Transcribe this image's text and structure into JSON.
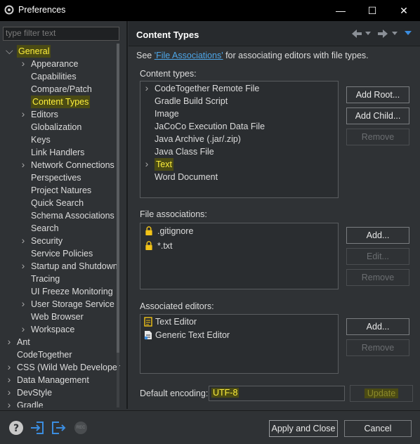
{
  "window": {
    "title": "Preferences",
    "controls": {
      "minimize": "—",
      "maximize": "☐",
      "close": "✕"
    }
  },
  "left": {
    "filter_placeholder": "type filter text",
    "tree": [
      {
        "label": "General",
        "level": 0,
        "expander": "open",
        "highlight": true
      },
      {
        "label": "Appearance",
        "level": 1,
        "expander": "closed"
      },
      {
        "label": "Capabilities",
        "level": 1,
        "expander": "none"
      },
      {
        "label": "Compare/Patch",
        "level": 1,
        "expander": "none"
      },
      {
        "label": "Content Types",
        "level": 1,
        "expander": "none",
        "highlight": true,
        "selected": true
      },
      {
        "label": "Editors",
        "level": 1,
        "expander": "closed"
      },
      {
        "label": "Globalization",
        "level": 1,
        "expander": "none"
      },
      {
        "label": "Keys",
        "level": 1,
        "expander": "none"
      },
      {
        "label": "Link Handlers",
        "level": 1,
        "expander": "none"
      },
      {
        "label": "Network Connections",
        "level": 1,
        "expander": "closed"
      },
      {
        "label": "Perspectives",
        "level": 1,
        "expander": "none"
      },
      {
        "label": "Project Natures",
        "level": 1,
        "expander": "none"
      },
      {
        "label": "Quick Search",
        "level": 1,
        "expander": "none"
      },
      {
        "label": "Schema Associations",
        "level": 1,
        "expander": "none"
      },
      {
        "label": "Search",
        "level": 1,
        "expander": "none"
      },
      {
        "label": "Security",
        "level": 1,
        "expander": "closed"
      },
      {
        "label": "Service Policies",
        "level": 1,
        "expander": "none"
      },
      {
        "label": "Startup and Shutdown",
        "level": 1,
        "expander": "closed"
      },
      {
        "label": "Tracing",
        "level": 1,
        "expander": "none"
      },
      {
        "label": "UI Freeze Monitoring",
        "level": 1,
        "expander": "none"
      },
      {
        "label": "User Storage Service",
        "level": 1,
        "expander": "closed"
      },
      {
        "label": "Web Browser",
        "level": 1,
        "expander": "none"
      },
      {
        "label": "Workspace",
        "level": 1,
        "expander": "closed"
      },
      {
        "label": "Ant",
        "level": 0,
        "expander": "closed"
      },
      {
        "label": "CodeTogether",
        "level": 0,
        "expander": "none"
      },
      {
        "label": "CSS (Wild Web Developer",
        "level": 0,
        "expander": "closed"
      },
      {
        "label": "Data Management",
        "level": 0,
        "expander": "closed"
      },
      {
        "label": "DevStyle",
        "level": 0,
        "expander": "closed"
      },
      {
        "label": "Gradle",
        "level": 0,
        "expander": "closed"
      }
    ]
  },
  "page": {
    "title": "Content Types",
    "see_prefix": "See ",
    "see_link": "'File Associations'",
    "see_suffix": " for associating editors with file types.",
    "content_types_label": "Content types:",
    "content_types": [
      {
        "label": "CodeTogether Remote File",
        "expander": true
      },
      {
        "label": "Gradle Build Script",
        "expander": false
      },
      {
        "label": "Image",
        "expander": false
      },
      {
        "label": "JaCoCo Execution Data File",
        "expander": false
      },
      {
        "label": "Java Archive (.jar/.zip)",
        "expander": false
      },
      {
        "label": "Java Class File",
        "expander": false
      },
      {
        "label": "Text",
        "expander": true,
        "highlight": true
      },
      {
        "label": "Word Document",
        "expander": false
      }
    ],
    "buttons_content": {
      "add_root": "Add Root...",
      "add_child": "Add Child...",
      "remove": "Remove"
    },
    "file_assoc_label": "File associations:",
    "file_associations": [
      ".gitignore",
      "*.txt"
    ],
    "buttons_assoc": {
      "add": "Add...",
      "edit": "Edit...",
      "remove": "Remove"
    },
    "editors_label": "Associated editors:",
    "editors": [
      {
        "label": "Text Editor",
        "icon": "text-editor-icon"
      },
      {
        "label": "Generic Text Editor",
        "icon": "generic-editor-icon"
      }
    ],
    "buttons_editors": {
      "add": "Add...",
      "remove": "Remove"
    },
    "encoding_label": "Default encoding:",
    "encoding_value": "UTF-8",
    "update": "Update"
  },
  "bottom": {
    "apply_close": "Apply and Close",
    "cancel": "Cancel",
    "rec": "REC"
  },
  "colors": {
    "highlight_bg": "#4b4b14",
    "highlight_fg": "#fff03c",
    "link": "#4ea6e8",
    "nav_arrow": "#8a8f96",
    "dropdown_arrow": "#3b8de0"
  }
}
